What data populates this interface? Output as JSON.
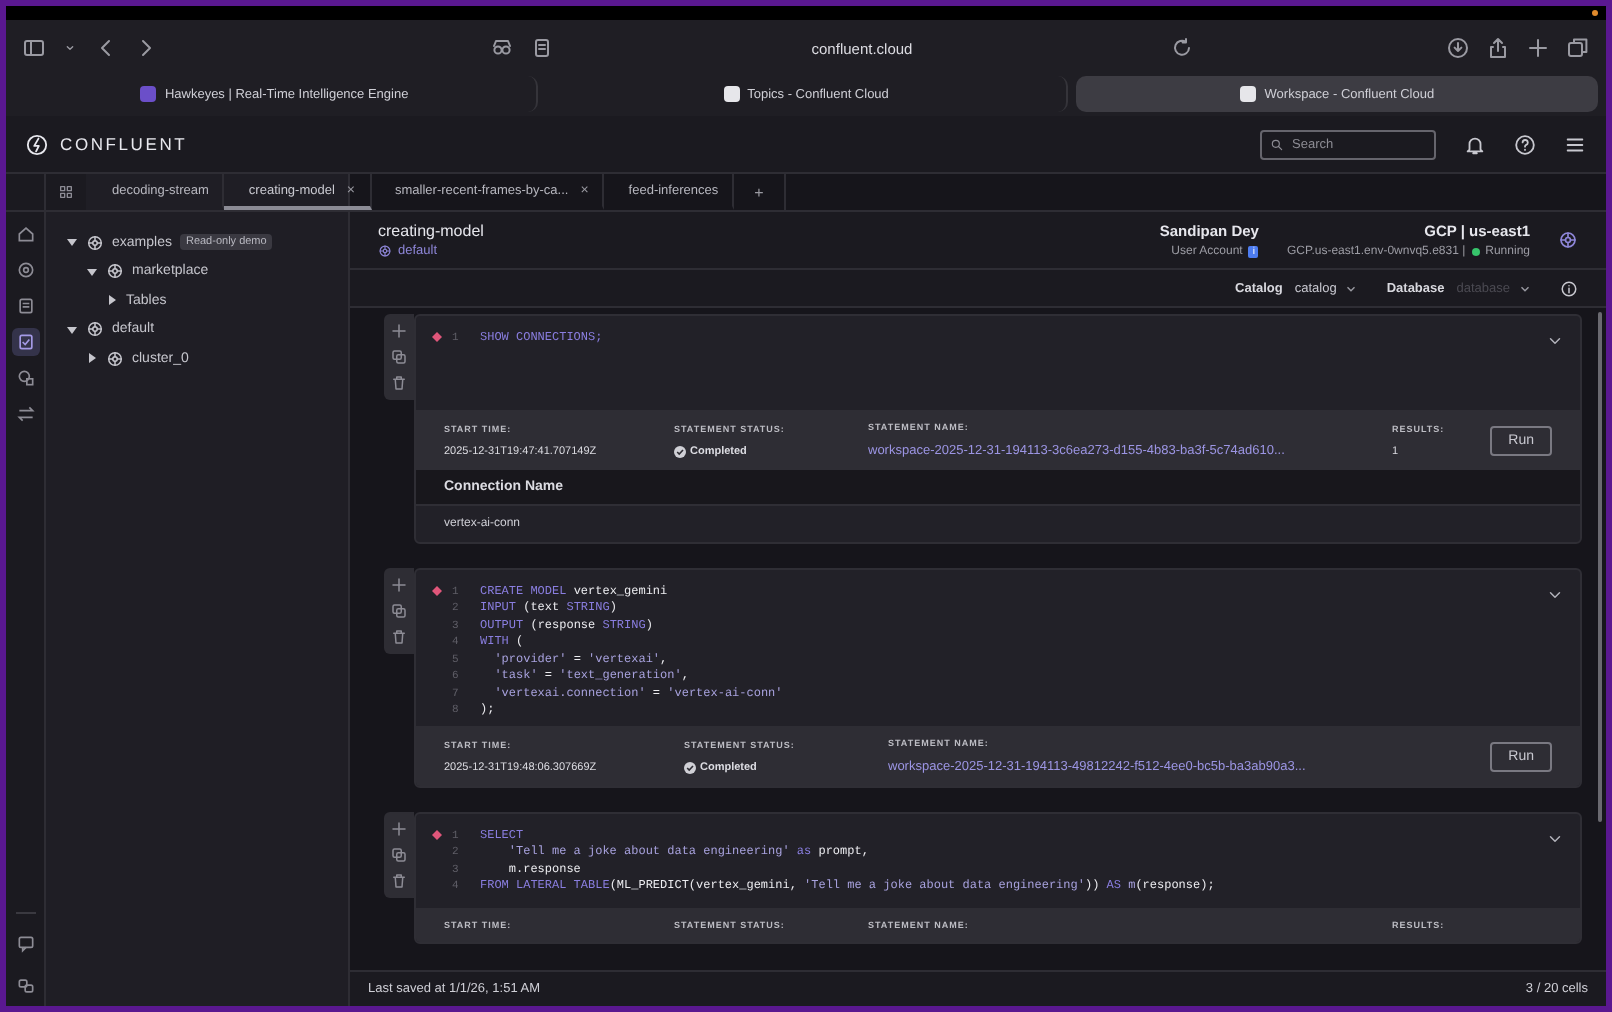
{
  "browser": {
    "url": "confluent.cloud",
    "tabs": [
      {
        "title": "Hawkeyes | Real-Time Intelligence Engine",
        "selected": false
      },
      {
        "title": "Topics - Confluent Cloud",
        "selected": false
      },
      {
        "title": "Workspace - Confluent Cloud",
        "selected": true
      }
    ]
  },
  "app": {
    "logo": "CONFLUENT",
    "search": {
      "placeholder": "Search"
    }
  },
  "rail": {
    "top": [
      {
        "selected": false
      },
      {
        "selected": false
      },
      {
        "selected": false
      },
      {
        "selected": true
      },
      {
        "selected": false
      },
      {
        "selected": false
      }
    ],
    "bottom": [
      {
        "selected": false
      },
      {
        "selected": false
      }
    ]
  },
  "tabs": [
    {
      "label": "decoding-stream",
      "selected": false
    },
    {
      "label": "creating-model",
      "selected": true,
      "close": "×"
    },
    {
      "label": "smaller-recent-frames-by-ca...",
      "selected": false,
      "close": "×"
    },
    {
      "label": "feed-inferences",
      "selected": false
    }
  ],
  "new_tab": "+",
  "tree": [
    {
      "label": "examples",
      "kind": "database",
      "badge": "Read-only demo",
      "expanded": true,
      "children": [
        {
          "label": "marketplace",
          "kind": "database",
          "expanded": true,
          "children": [
            {
              "label": "Tables",
              "expanded": false
            }
          ]
        }
      ]
    },
    {
      "label": "default",
      "kind": "database",
      "expanded": true,
      "children": [
        {
          "label": "cluster_0",
          "kind": "database",
          "expanded": false
        }
      ]
    }
  ],
  "workspace": {
    "title": "creating-model",
    "environment": "default",
    "user_name": "Sandipan Dey",
    "user_type": "User Account",
    "user_badge": "i",
    "region": "GCP | us-east1",
    "compute_pool": "GCP.us-east1.env-0wnvq5.e831 |",
    "pool_status": "Running",
    "catalog_label": "Catalog",
    "catalog_value": "catalog",
    "database_label": "Database",
    "database_placeholder": "database"
  },
  "cells": [
    {
      "lines": [
        {
          "number": "1",
          "tokens": [
            {
              "text": "SHOW CONNECTIONS;",
              "kind": "keyword"
            }
          ]
        }
      ],
      "meta": {
        "start_time_label": "START TIME:",
        "start_time": "2025-12-31T19:47:41.707149Z",
        "status_label": "STATEMENT STATUS:",
        "status": "Completed",
        "name_label": "STATEMENT NAME:",
        "name": "workspace-2025-12-31-194113-3c6ea273-d155-4b83-ba3f-5c74ad610...",
        "results_label": "RESULTS:",
        "results": "1",
        "run": "Run"
      },
      "result_table": {
        "column": "Connection Name",
        "rows": [
          "vertex-ai-conn"
        ]
      }
    },
    {
      "lines": [
        {
          "number": "1",
          "tokens": [
            {
              "text": "CREATE MODEL ",
              "kind": "keyword"
            },
            {
              "text": "vertex_gemini",
              "kind": "plain"
            }
          ]
        },
        {
          "number": "2",
          "tokens": [
            {
              "text": "INPUT ",
              "kind": "keyword"
            },
            {
              "text": "(text ",
              "kind": "plain"
            },
            {
              "text": "STRING",
              "kind": "keyword"
            },
            {
              "text": ")",
              "kind": "plain"
            }
          ]
        },
        {
          "number": "3",
          "tokens": [
            {
              "text": "OUTPUT ",
              "kind": "keyword"
            },
            {
              "text": "(response ",
              "kind": "plain"
            },
            {
              "text": "STRING",
              "kind": "keyword"
            },
            {
              "text": ")",
              "kind": "plain"
            }
          ]
        },
        {
          "number": "4",
          "tokens": [
            {
              "text": "WITH ",
              "kind": "keyword"
            },
            {
              "text": "(",
              "kind": "plain"
            }
          ]
        },
        {
          "number": "5",
          "tokens": [
            {
              "text": "  'provider'",
              "kind": "string"
            },
            {
              "text": " = ",
              "kind": "plain"
            },
            {
              "text": "'vertexai'",
              "kind": "string"
            },
            {
              "text": ",",
              "kind": "plain"
            }
          ]
        },
        {
          "number": "6",
          "tokens": [
            {
              "text": "  'task'",
              "kind": "string"
            },
            {
              "text": " = ",
              "kind": "plain"
            },
            {
              "text": "'text_generation'",
              "kind": "string"
            },
            {
              "text": ",",
              "kind": "plain"
            }
          ]
        },
        {
          "number": "7",
          "tokens": [
            {
              "text": "  'vertexai.connection'",
              "kind": "string"
            },
            {
              "text": " = ",
              "kind": "plain"
            },
            {
              "text": "'vertex-ai-conn'",
              "kind": "string"
            }
          ]
        },
        {
          "number": "8",
          "tokens": [
            {
              "text": ");",
              "kind": "plain"
            }
          ]
        }
      ],
      "meta": {
        "start_time_label": "START TIME:",
        "start_time": "2025-12-31T19:48:06.307669Z",
        "status_label": "STATEMENT STATUS:",
        "status": "Completed",
        "name_label": "STATEMENT NAME:",
        "name": "workspace-2025-12-31-194113-49812242-f512-4ee0-bc5b-ba3ab90a3...",
        "run": "Run"
      }
    },
    {
      "lines": [
        {
          "number": "1",
          "tokens": [
            {
              "text": "SELECT",
              "kind": "keyword"
            }
          ]
        },
        {
          "number": "2",
          "tokens": [
            {
              "text": "    'Tell me a joke about data engineering'",
              "kind": "string"
            },
            {
              "text": " as ",
              "kind": "keyword"
            },
            {
              "text": "prompt,",
              "kind": "plain"
            }
          ]
        },
        {
          "number": "3",
          "tokens": [
            {
              "text": "    m.response",
              "kind": "plain"
            }
          ]
        },
        {
          "number": "4",
          "tokens": [
            {
              "text": "FROM LATERAL TABLE",
              "kind": "keyword"
            },
            {
              "text": "(ML_PREDICT(vertex_gemini, ",
              "kind": "plain"
            },
            {
              "text": "'Tell me a joke about data engineering'",
              "kind": "string"
            },
            {
              "text": ")) ",
              "kind": "plain"
            },
            {
              "text": "AS ",
              "kind": "keyword"
            },
            {
              "text": "m",
              "kind": "string"
            },
            {
              "text": "(response);",
              "kind": "plain"
            }
          ]
        }
      ],
      "meta": {
        "start_time_label": "START TIME:",
        "status_label": "STATEMENT STATUS:",
        "name_label": "STATEMENT NAME:",
        "results_label": "RESULTS:"
      }
    }
  ],
  "footer": {
    "saved": "Last saved at 1/1/26, 1:51 AM",
    "cells": "3 / 20 cells"
  }
}
